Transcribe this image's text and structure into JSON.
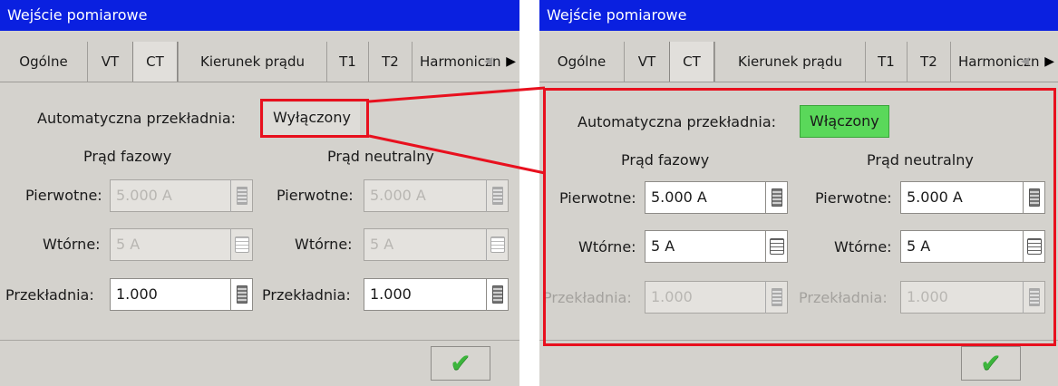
{
  "left": {
    "title": "Wejście pomiarowe",
    "tabs": [
      "Ogólne",
      "VT",
      "CT",
      "Kierunek prądu",
      "T1",
      "T2",
      "Harmoniczn"
    ],
    "auto_label": "Automatyczna przekładnia:",
    "auto_value": "Wyłączony",
    "phase_header": "Prąd fazowy",
    "neutral_header": "Prąd neutralny",
    "primary_label": "Pierwotne:",
    "secondary_label": "Wtórne:",
    "ratio_label": "Przekładnia:",
    "phase_primary": "5.000 A",
    "phase_secondary": "5 A",
    "phase_ratio": "1.000",
    "neutral_primary": "5.000 A",
    "neutral_secondary": "5 A",
    "neutral_ratio": "1.000"
  },
  "right": {
    "title": "Wejście pomiarowe",
    "tabs": [
      "Ogólne",
      "VT",
      "CT",
      "Kierunek prądu",
      "T1",
      "T2",
      "Harmoniczn"
    ],
    "auto_label": "Automatyczna przekładnia:",
    "auto_value": "Włączony",
    "phase_header": "Prąd fazowy",
    "neutral_header": "Prąd neutralny",
    "primary_label": "Pierwotne:",
    "secondary_label": "Wtórne:",
    "ratio_label": "Przekładnia:",
    "phase_primary": "5.000 A",
    "phase_secondary": "5 A",
    "phase_ratio": "1.000",
    "neutral_primary": "5.000 A",
    "neutral_secondary": "5 A",
    "neutral_ratio": "1.000"
  },
  "icons": {
    "calculator": "calculator-icon",
    "list": "list-icon",
    "confirm": "checkmark-icon",
    "tab_scroll": "tab-scroll-arrow-icon"
  },
  "colors": {
    "title_bar": "#0a20e0",
    "highlight": "#e8101e",
    "auto_on": "#5ad85a",
    "auto_off": "#dedcd8",
    "check": "#3cb53c"
  }
}
